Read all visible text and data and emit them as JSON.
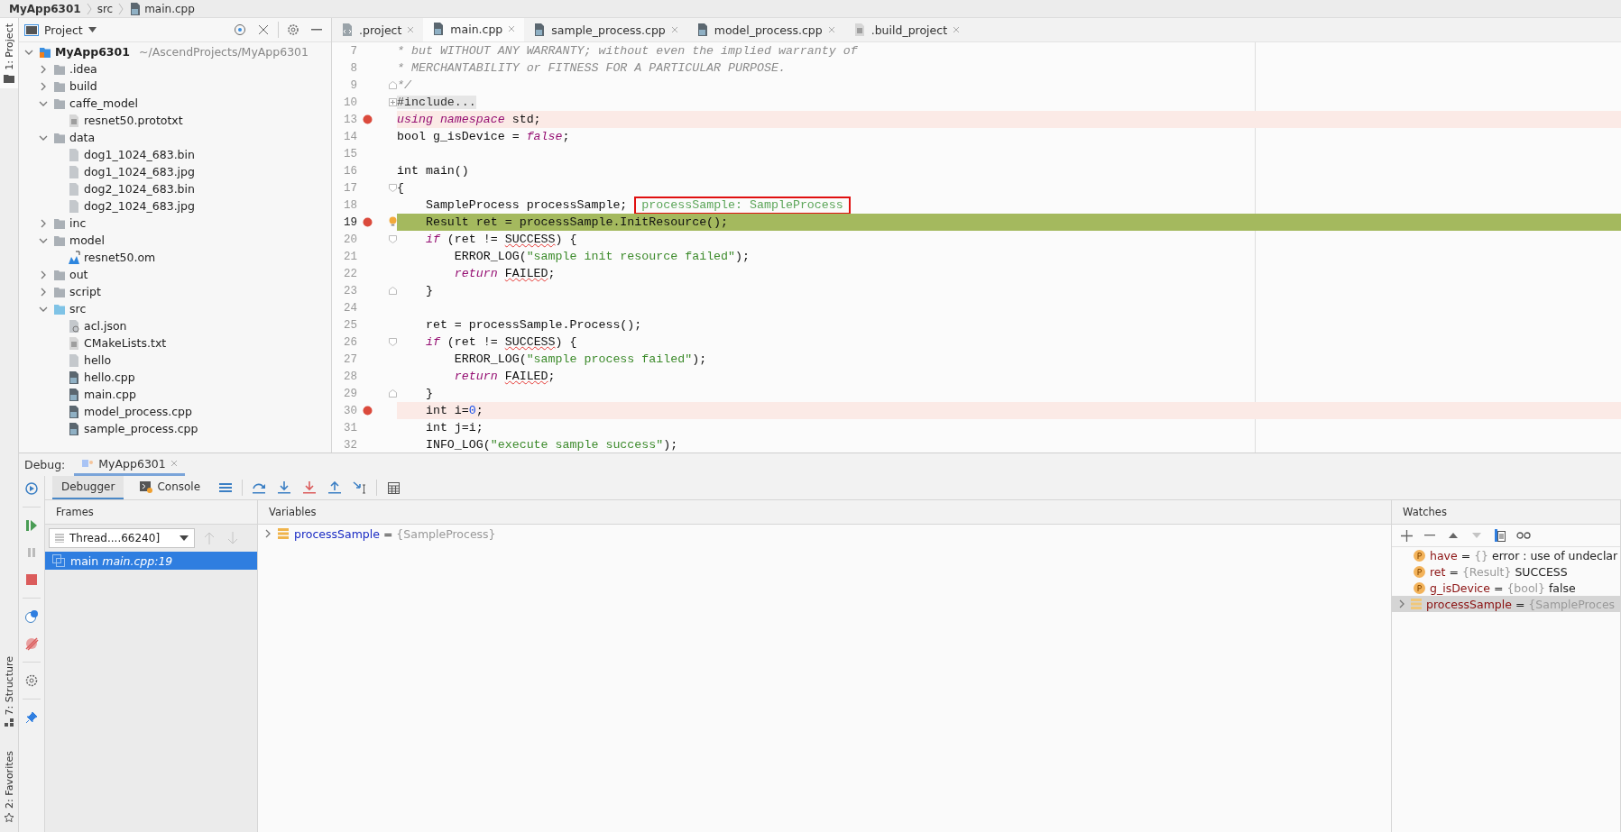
{
  "breadcrumb": [
    {
      "label": "MyApp6301",
      "kind": "project"
    },
    {
      "label": "src",
      "kind": "folder"
    },
    {
      "label": "main.cpp",
      "kind": "cpp"
    }
  ],
  "stripe": {
    "top": [
      {
        "label": "1: Project",
        "kind": "folder",
        "selected": true
      }
    ],
    "bottom": [
      {
        "label": "7: Structure",
        "kind": "structure",
        "selected": false
      },
      {
        "label": "2: Favorites",
        "kind": "star",
        "selected": false
      }
    ]
  },
  "project_panel": {
    "title": "Project",
    "tree": [
      {
        "label": "MyApp6301",
        "path": "~/AscendProjects/MyApp6301",
        "kind": "module",
        "expanded": true,
        "children": [
          {
            "label": ".idea",
            "kind": "folder",
            "expanded": false
          },
          {
            "label": "build",
            "kind": "folder",
            "expanded": false
          },
          {
            "label": "caffe_model",
            "kind": "folder",
            "expanded": true,
            "children": [
              {
                "label": "resnet50.prototxt",
                "kind": "text"
              }
            ]
          },
          {
            "label": "data",
            "kind": "folder",
            "expanded": true,
            "children": [
              {
                "label": "dog1_1024_683.bin",
                "kind": "unknown"
              },
              {
                "label": "dog1_1024_683.jpg",
                "kind": "unknown"
              },
              {
                "label": "dog2_1024_683.bin",
                "kind": "unknown"
              },
              {
                "label": "dog2_1024_683.jpg",
                "kind": "unknown"
              }
            ]
          },
          {
            "label": "inc",
            "kind": "folder",
            "expanded": false
          },
          {
            "label": "model",
            "kind": "folder",
            "expanded": true,
            "children": [
              {
                "label": "resnet50.om",
                "kind": "model"
              }
            ]
          },
          {
            "label": "out",
            "kind": "folder",
            "expanded": false
          },
          {
            "label": "script",
            "kind": "folder",
            "expanded": false
          },
          {
            "label": "src",
            "kind": "source",
            "expanded": true,
            "children": [
              {
                "label": "acl.json",
                "kind": "json"
              },
              {
                "label": "CMakeLists.txt",
                "kind": "text"
              },
              {
                "label": "hello",
                "kind": "unknown"
              },
              {
                "label": "hello.cpp",
                "kind": "cpp"
              },
              {
                "label": "main.cpp",
                "kind": "cpp"
              },
              {
                "label": "model_process.cpp",
                "kind": "cpp"
              },
              {
                "label": "sample_process.cpp",
                "kind": "cpp"
              }
            ]
          }
        ]
      }
    ]
  },
  "editor": {
    "tabs": [
      {
        "label": ".project",
        "kind": "xml",
        "selected": false
      },
      {
        "label": "main.cpp",
        "kind": "cpp",
        "selected": true
      },
      {
        "label": "sample_process.cpp",
        "kind": "cpp",
        "selected": false
      },
      {
        "label": "model_process.cpp",
        "kind": "cpp",
        "selected": false
      },
      {
        "label": ".build_project",
        "kind": "text",
        "selected": false
      }
    ],
    "lines": [
      {
        "number": "7",
        "breakpoint": false,
        "segments": [
          {
            "kind": "comment",
            "text": "* but WITHOUT ANY WARRANTY; without even the implied warranty of"
          }
        ]
      },
      {
        "number": "8",
        "breakpoint": false,
        "segments": [
          {
            "kind": "comment",
            "text": "* MERCHANTABILITY or FITNESS FOR A PARTICULAR PURPOSE."
          }
        ]
      },
      {
        "number": "9",
        "breakpoint": false,
        "fold_end": true,
        "segments": [
          {
            "kind": "comment",
            "text": "*/"
          }
        ]
      },
      {
        "number": "10",
        "breakpoint": false,
        "collapsed": true,
        "segments": [
          {
            "kind": "folded",
            "text": "#include..."
          }
        ]
      },
      {
        "number": "13",
        "breakpoint": true,
        "segments": [
          {
            "kind": "keyword",
            "text": "using namespace"
          },
          {
            "kind": "plain",
            "text": " std;"
          }
        ]
      },
      {
        "number": "14",
        "breakpoint": false,
        "segments": [
          {
            "kind": "plain",
            "text": "bool g_isDevice = "
          },
          {
            "kind": "keyword",
            "text": "false"
          },
          {
            "kind": "plain",
            "text": ";"
          }
        ]
      },
      {
        "number": "15",
        "breakpoint": false
      },
      {
        "number": "16",
        "breakpoint": false,
        "segments": [
          {
            "kind": "plain",
            "text": "int main()"
          }
        ]
      },
      {
        "number": "17",
        "breakpoint": false,
        "fold_start": true,
        "segments": [
          {
            "kind": "plain",
            "text": "{"
          }
        ]
      },
      {
        "number": "18",
        "breakpoint": false,
        "segments": [
          {
            "kind": "plain",
            "text": "    SampleProcess processSample;"
          }
        ],
        "hint": "processSample: SampleProcess"
      },
      {
        "number": "19",
        "breakpoint": true,
        "current": true,
        "segments": [
          {
            "kind": "plain",
            "text": "    Result ret = processSample.InitResource();"
          }
        ]
      },
      {
        "number": "20",
        "breakpoint": false,
        "fold_start": true,
        "segments": [
          {
            "kind": "keyword",
            "text": "    if"
          },
          {
            "kind": "plain",
            "text": " (ret != "
          },
          {
            "kind": "error",
            "text": "SUCCESS"
          },
          {
            "kind": "plain",
            "text": ") {"
          }
        ]
      },
      {
        "number": "21",
        "breakpoint": false,
        "segments": [
          {
            "kind": "plain",
            "text": "        ERROR_LOG("
          },
          {
            "kind": "string",
            "text": "\"sample init resource failed\""
          },
          {
            "kind": "plain",
            "text": ");"
          }
        ]
      },
      {
        "number": "22",
        "breakpoint": false,
        "segments": [
          {
            "kind": "keyword",
            "text": "        return "
          },
          {
            "kind": "error",
            "text": "FAILED"
          },
          {
            "kind": "plain",
            "text": ";"
          }
        ]
      },
      {
        "number": "23",
        "breakpoint": false,
        "fold_end": true,
        "segments": [
          {
            "kind": "plain",
            "text": "    }"
          }
        ]
      },
      {
        "number": "24",
        "breakpoint": false
      },
      {
        "number": "25",
        "breakpoint": false,
        "segments": [
          {
            "kind": "plain",
            "text": "    ret = processSample.Process();"
          }
        ]
      },
      {
        "number": "26",
        "breakpoint": false,
        "fold_start": true,
        "segments": [
          {
            "kind": "keyword",
            "text": "    if"
          },
          {
            "kind": "plain",
            "text": " (ret != "
          },
          {
            "kind": "error",
            "text": "SUCCESS"
          },
          {
            "kind": "plain",
            "text": ") {"
          }
        ]
      },
      {
        "number": "27",
        "breakpoint": false,
        "segments": [
          {
            "kind": "plain",
            "text": "        ERROR_LOG("
          },
          {
            "kind": "string",
            "text": "\"sample process failed\""
          },
          {
            "kind": "plain",
            "text": ");"
          }
        ]
      },
      {
        "number": "28",
        "breakpoint": false,
        "segments": [
          {
            "kind": "keyword",
            "text": "        return "
          },
          {
            "kind": "error",
            "text": "FAILED"
          },
          {
            "kind": "plain",
            "text": ";"
          }
        ]
      },
      {
        "number": "29",
        "breakpoint": false,
        "fold_end": true,
        "segments": [
          {
            "kind": "plain",
            "text": "    }"
          }
        ]
      },
      {
        "number": "30",
        "breakpoint": true,
        "segments": [
          {
            "kind": "plain",
            "text": "    int i="
          },
          {
            "kind": "number",
            "text": "0"
          },
          {
            "kind": "plain",
            "text": ";"
          }
        ]
      },
      {
        "number": "31",
        "breakpoint": false,
        "segments": [
          {
            "kind": "plain",
            "text": "    int j=i;"
          }
        ]
      },
      {
        "number": "32",
        "breakpoint": false,
        "segments": [
          {
            "kind": "plain",
            "text": "    INFO_LOG("
          },
          {
            "kind": "string",
            "text": "\"execute sample success\""
          },
          {
            "kind": "plain",
            "text": ");"
          }
        ]
      }
    ]
  },
  "debug": {
    "title": "Debug:",
    "session": "MyApp6301",
    "tabs": [
      {
        "label": "Debugger",
        "kind": "plain",
        "selected": true
      },
      {
        "label": "Console",
        "kind": "console",
        "selected": false
      }
    ],
    "frames": {
      "title": "Frames",
      "thread": "Thread....66240]",
      "items": [
        {
          "text": "main *main.cpp:19*",
          "selected": true
        }
      ]
    },
    "variables": {
      "title": "Variables",
      "items": [
        {
          "name": "processSample",
          "op": "=",
          "type": "{SampleProcess}",
          "expanded": false
        }
      ]
    },
    "watches": {
      "title": "Watches",
      "items": [
        {
          "kind": "primitive",
          "name": "have",
          "op": "=",
          "type": "{}",
          "value": "error : use of undeclar",
          "selected": false
        },
        {
          "kind": "primitive",
          "name": "ret",
          "op": "=",
          "type": "{Result}",
          "value": "SUCCESS",
          "selected": false
        },
        {
          "kind": "primitive",
          "name": "g_isDevice",
          "op": "=",
          "type": "{bool}",
          "value": "false",
          "selected": false
        },
        {
          "kind": "object",
          "name": "processSample",
          "op": "=",
          "type": "{SampleProces",
          "selected": true
        }
      ]
    }
  }
}
